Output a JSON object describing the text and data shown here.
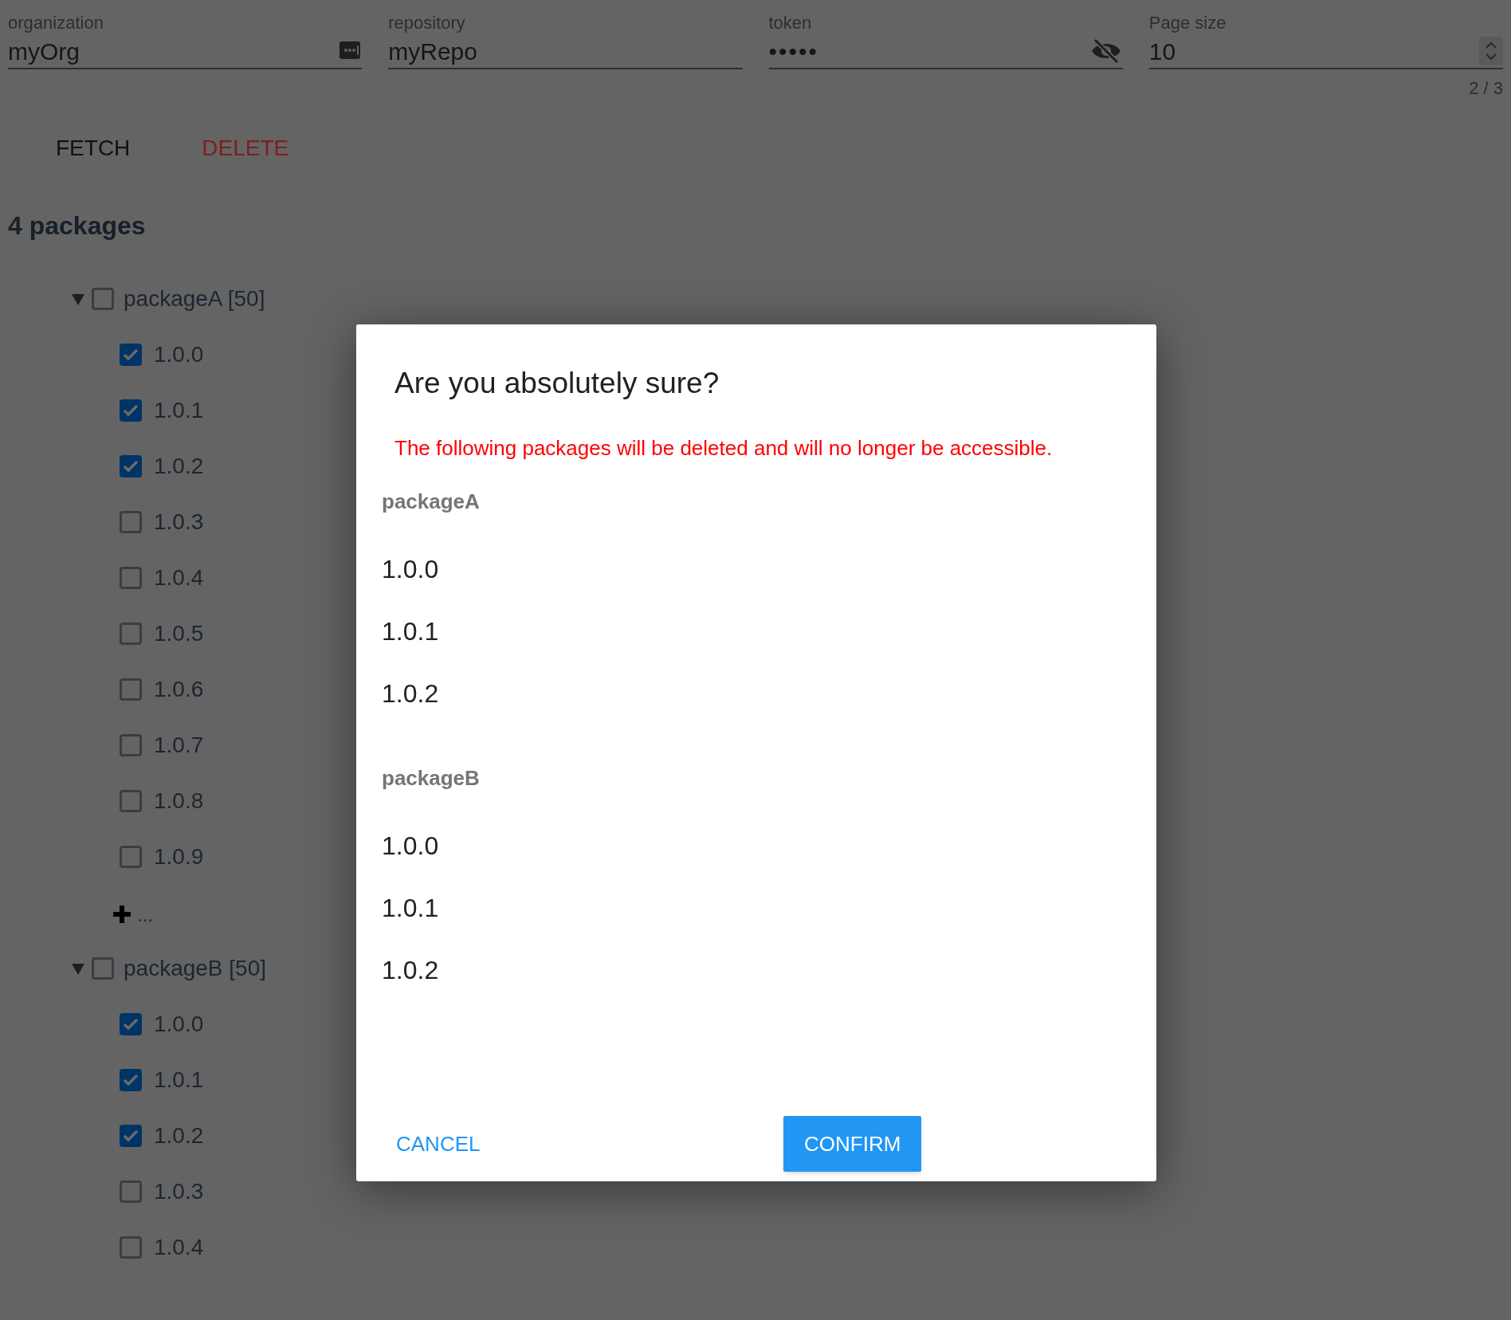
{
  "fields": [
    {
      "label": "organization",
      "value": "myOrg",
      "kind": "autofill"
    },
    {
      "label": "repository",
      "value": "myRepo",
      "kind": "text"
    },
    {
      "label": "token",
      "value": "•••••",
      "kind": "password"
    },
    {
      "label": "Page size",
      "value": "10",
      "kind": "number"
    }
  ],
  "page_indicator": "2 / 3",
  "actions": [
    {
      "label": "FETCH",
      "kind": "default"
    },
    {
      "label": "DELETE",
      "kind": "danger"
    }
  ],
  "heading": "4 packages",
  "packages": [
    {
      "name": "packageA [50]",
      "expanded": true,
      "checked": false,
      "more": "...",
      "versions": [
        {
          "label": "1.0.0",
          "checked": true
        },
        {
          "label": "1.0.1",
          "checked": true
        },
        {
          "label": "1.0.2",
          "checked": true
        },
        {
          "label": "1.0.3",
          "checked": false
        },
        {
          "label": "1.0.4",
          "checked": false
        },
        {
          "label": "1.0.5",
          "checked": false
        },
        {
          "label": "1.0.6",
          "checked": false
        },
        {
          "label": "1.0.7",
          "checked": false
        },
        {
          "label": "1.0.8",
          "checked": false
        },
        {
          "label": "1.0.9",
          "checked": false
        }
      ]
    },
    {
      "name": "packageB [50]",
      "expanded": true,
      "checked": false,
      "versions": [
        {
          "label": "1.0.0",
          "checked": true
        },
        {
          "label": "1.0.1",
          "checked": true
        },
        {
          "label": "1.0.2",
          "checked": true
        },
        {
          "label": "1.0.3",
          "checked": false
        },
        {
          "label": "1.0.4",
          "checked": false
        }
      ]
    }
  ],
  "dialog": {
    "title": "Are you absolutely sure?",
    "warning": "The following packages will be deleted and will no longer be accessible.",
    "groups": [
      {
        "name": "packageA",
        "versions": [
          "1.0.0",
          "1.0.1",
          "1.0.2"
        ]
      },
      {
        "name": "packageB",
        "versions": [
          "1.0.0",
          "1.0.1",
          "1.0.2"
        ]
      }
    ],
    "buttons": [
      {
        "label": "CANCEL",
        "kind": "text"
      },
      {
        "label": "CONFIRM",
        "kind": "primary"
      }
    ]
  }
}
